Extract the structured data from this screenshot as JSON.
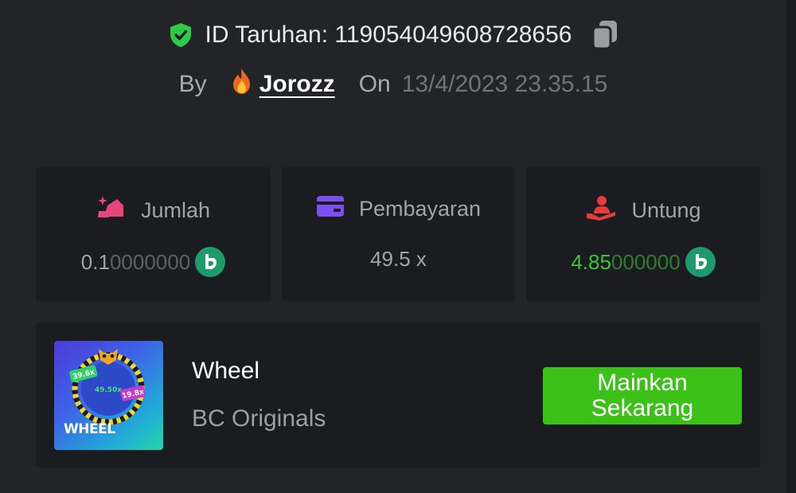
{
  "bet": {
    "id_label": "ID Taruhan:",
    "id_value": "119054049608728656",
    "by_label": "By",
    "username": "Jorozz",
    "on_label": "On",
    "datetime": "13/4/2023 23.35.15"
  },
  "stats": {
    "amount": {
      "label": "Jumlah",
      "value_main": "0.1",
      "value_dim": "0000000"
    },
    "payout": {
      "label": "Pembayaran",
      "value": "49.5 x"
    },
    "profit": {
      "label": "Untung",
      "value_main": "4.85",
      "value_dim": "000000"
    }
  },
  "game": {
    "title": "Wheel",
    "provider": "BC Originals",
    "thumb_text": "WHEEL",
    "thumb_chips": [
      "39.6x",
      "49.50x",
      "19.8x"
    ],
    "play_label": "Mainkan Sekarang"
  },
  "colors": {
    "accent_green": "#3bc117",
    "profit_green": "#40c33b",
    "shield_green": "#2ecb48",
    "amount_icon_pink": "#e8457a",
    "payout_icon_purple": "#7b4ff0",
    "profit_icon_red": "#e53c3c",
    "coin_green": "#1e9a6c"
  },
  "icons": {
    "verified": "shield-check-icon",
    "copy": "copy-icon",
    "vip": "flame-icon",
    "amount": "bet-amount-icon",
    "payout": "card-icon",
    "profit": "hand-profit-icon",
    "currency": "bc-coin-icon"
  }
}
